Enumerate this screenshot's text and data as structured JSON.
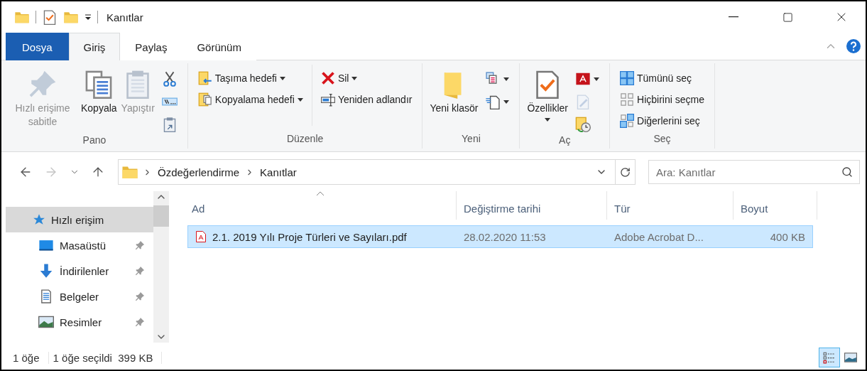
{
  "window": {
    "title": "Kanıtlar"
  },
  "ribbon_tabs": [
    {
      "label": "Dosya",
      "kind": "file",
      "selected": false
    },
    {
      "label": "Giriş",
      "kind": "tab",
      "selected": true
    },
    {
      "label": "Paylaş",
      "kind": "tab",
      "selected": false
    },
    {
      "label": "Görünüm",
      "kind": "tab",
      "selected": false
    }
  ],
  "ribbon_groups": [
    {
      "name": "Pano",
      "items": [
        {
          "kind": "large",
          "label": "Hızlı erişime sabitle",
          "disabled": true,
          "dropdown": false
        },
        {
          "kind": "large",
          "label": "Kopyala",
          "disabled": false,
          "dropdown": false
        },
        {
          "kind": "large",
          "label": "Yapıştır",
          "disabled": true,
          "dropdown": false
        },
        {
          "kind": "stack",
          "items": [
            {
              "disabled": false,
              "dropdown": false
            },
            {
              "disabled": false,
              "dropdown": false
            },
            {
              "disabled": false,
              "dropdown": false
            }
          ]
        }
      ]
    },
    {
      "name": "Düzenle",
      "items": [
        {
          "kind": "stack",
          "items": [
            {
              "label": "Taşıma hedefi",
              "disabled": false,
              "dropdown": true
            },
            {
              "label": "Kopyalama hedefi",
              "disabled": false,
              "dropdown": true
            }
          ]
        },
        {
          "kind": "stack",
          "items": [
            {
              "label": "Sil",
              "disabled": false,
              "dropdown": true
            },
            {
              "label": "Yeniden adlandır",
              "disabled": false,
              "dropdown": false
            }
          ]
        }
      ]
    },
    {
      "name": "Yeni",
      "items": [
        {
          "kind": "large",
          "label": "Yeni klasör",
          "disabled": false,
          "dropdown": false
        },
        {
          "kind": "stack",
          "items": [
            {
              "disabled": false,
              "dropdown": true
            },
            {
              "disabled": false,
              "dropdown": true
            }
          ]
        }
      ]
    },
    {
      "name": "Aç",
      "items": [
        {
          "kind": "large",
          "label": "Özellikler",
          "disabled": false,
          "dropdown": true
        },
        {
          "kind": "stack",
          "items": [
            {
              "disabled": false,
              "dropdown": true
            },
            {
              "disabled": true,
              "dropdown": false
            },
            {
              "disabled": false,
              "dropdown": false
            }
          ]
        }
      ]
    },
    {
      "name": "Seç",
      "items": [
        {
          "kind": "stack",
          "items": [
            {
              "label": "Tümünü seç",
              "disabled": false,
              "dropdown": false
            },
            {
              "label": "Hiçbirini seçme",
              "disabled": false,
              "dropdown": false
            },
            {
              "label": "Diğerlerini seç",
              "disabled": false,
              "dropdown": false
            }
          ]
        }
      ]
    }
  ],
  "nav_buttons": [
    {
      "kind": "back",
      "disabled": false
    },
    {
      "kind": "forward",
      "disabled": true
    },
    {
      "kind": "recent",
      "disabled": false
    },
    {
      "kind": "up",
      "disabled": false
    }
  ],
  "address": {
    "breadcrumbs": [
      "Özdeğerlendirme",
      "Kanıtlar"
    ]
  },
  "search": {
    "placeholder": "Ara: Kanıtlar"
  },
  "sidebar": {
    "items": [
      {
        "label": "Hızlı erişim",
        "selected": true,
        "pinned": false
      },
      {
        "label": "Masaüstü",
        "selected": false,
        "pinned": true
      },
      {
        "label": "İndirilenler",
        "selected": false,
        "pinned": true
      },
      {
        "label": "Belgeler",
        "selected": false,
        "pinned": true
      },
      {
        "label": "Resimler",
        "selected": false,
        "pinned": true
      }
    ]
  },
  "table": {
    "columns": [
      {
        "label": "Ad",
        "sorted": true
      },
      {
        "label": "Değiştirme tarihi",
        "sorted": false
      },
      {
        "label": "Tür",
        "sorted": false
      },
      {
        "label": "Boyut",
        "sorted": false
      }
    ],
    "rows": [
      {
        "name": "2.1. 2019 Yılı Proje Türleri ve Sayıları.pdf",
        "date": "28.02.2020 11:53",
        "type": "Adobe Acrobat D...",
        "size": "400 KB",
        "selected": true
      }
    ]
  },
  "status_bar": {
    "items": [
      "1 öğe",
      "1 öğe seçildi  399 KB"
    ]
  },
  "view_buttons": [
    {
      "kind": "details",
      "selected": true
    },
    {
      "kind": "large-icons",
      "selected": false
    }
  ]
}
